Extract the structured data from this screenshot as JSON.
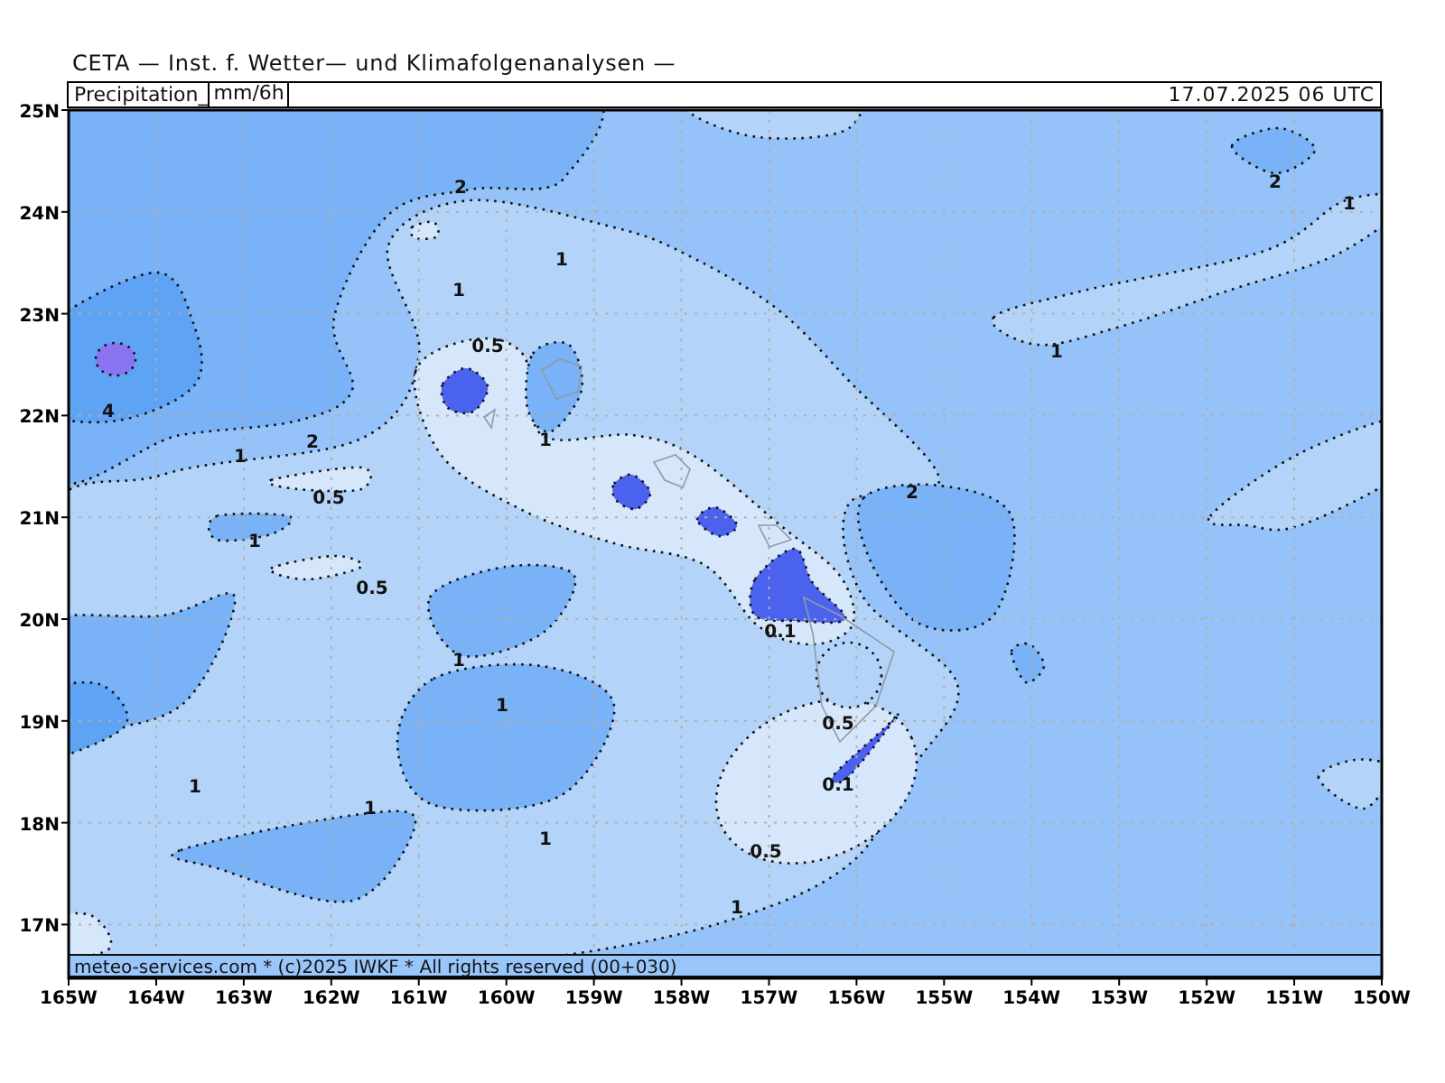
{
  "title": "CETA — Inst. f. Wetter— und Klimafolgenanalysen —",
  "header": {
    "variable": "Precipitation_",
    "unit": "mm/6h",
    "valid_time": "17.07.2025 06 UTC"
  },
  "map": {
    "lat_labels": [
      "25N",
      "24N",
      "23N",
      "22N",
      "21N",
      "20N",
      "19N",
      "18N",
      "17N"
    ],
    "lon_labels": [
      "165W",
      "164W",
      "163W",
      "162W",
      "161W",
      "160W",
      "159W",
      "158W",
      "157W",
      "156W",
      "155W",
      "154W",
      "153W",
      "152W",
      "151W",
      "150W"
    ],
    "contour_labels": [
      "2",
      "1",
      "1",
      "0.5",
      "4",
      "2",
      "1",
      "0.5",
      "1",
      "1",
      "0.5",
      "1",
      "1",
      "1",
      "1",
      "1",
      "0.1",
      "0.5",
      "0.1",
      "0.5",
      "1",
      "2",
      "1",
      "2",
      "1"
    ],
    "footer": "meteo-services.com * (c)2025 IWKF * All rights reserved (00+030)"
  }
}
